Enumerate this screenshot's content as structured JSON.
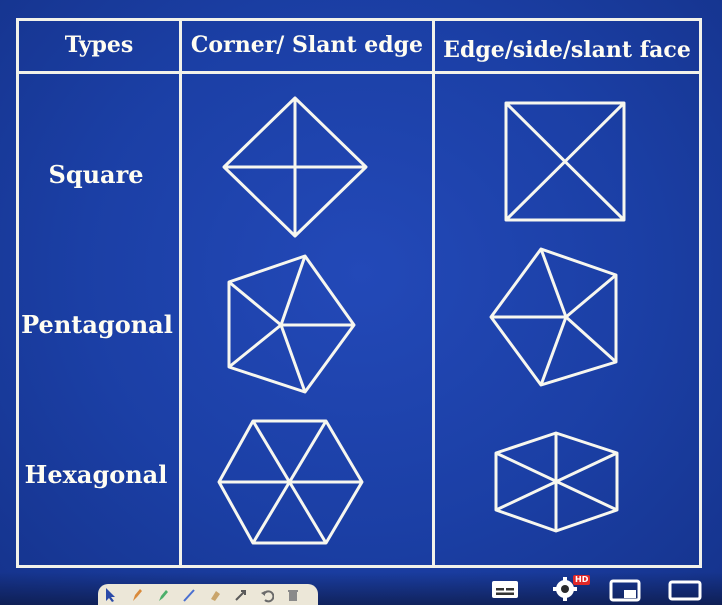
{
  "table": {
    "headers": [
      "Types",
      "Corner/ Slant edge",
      "Edge/side/slant face"
    ],
    "rows": [
      {
        "label": "Square"
      },
      {
        "label": "Pentagonal"
      },
      {
        "label": "Hexagonal"
      }
    ]
  },
  "player": {
    "hd_badge": "HD",
    "icons": [
      "subtitles-icon",
      "settings-icon",
      "miniplayer-icon",
      "theater-mode-icon"
    ]
  },
  "colors": {
    "background": "#1b3fa5",
    "lines": "#f2f2ea",
    "hd_badge": "#e02828"
  }
}
